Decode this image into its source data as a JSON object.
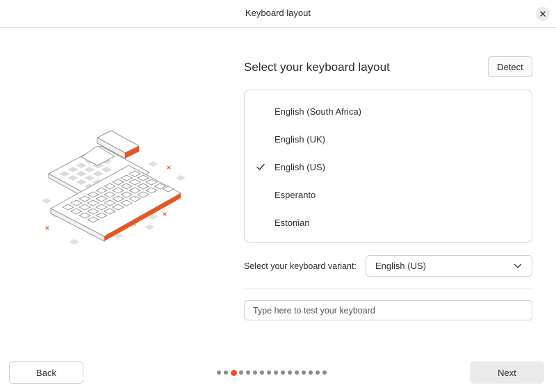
{
  "window": {
    "title": "Keyboard layout"
  },
  "main": {
    "heading": "Select your keyboard layout",
    "detect_label": "Detect",
    "layouts": [
      {
        "label": "English (South Africa)",
        "selected": false
      },
      {
        "label": "English (UK)",
        "selected": false
      },
      {
        "label": "English (US)",
        "selected": true
      },
      {
        "label": "Esperanto",
        "selected": false
      },
      {
        "label": "Estonian",
        "selected": false
      }
    ],
    "variant_label": "Select your keyboard variant:",
    "variant_value": "English (US)",
    "test_placeholder": "Type here to test your keyboard"
  },
  "footer": {
    "back_label": "Back",
    "next_label": "Next",
    "progress": {
      "total": 16,
      "current": 3
    }
  },
  "colors": {
    "accent": "#e95420",
    "dot_inactive": "#8a8a8a",
    "border": "#cfcfcf"
  },
  "icons": {
    "close": "close-icon",
    "check": "check-icon",
    "chevron": "chevron-down-icon"
  }
}
